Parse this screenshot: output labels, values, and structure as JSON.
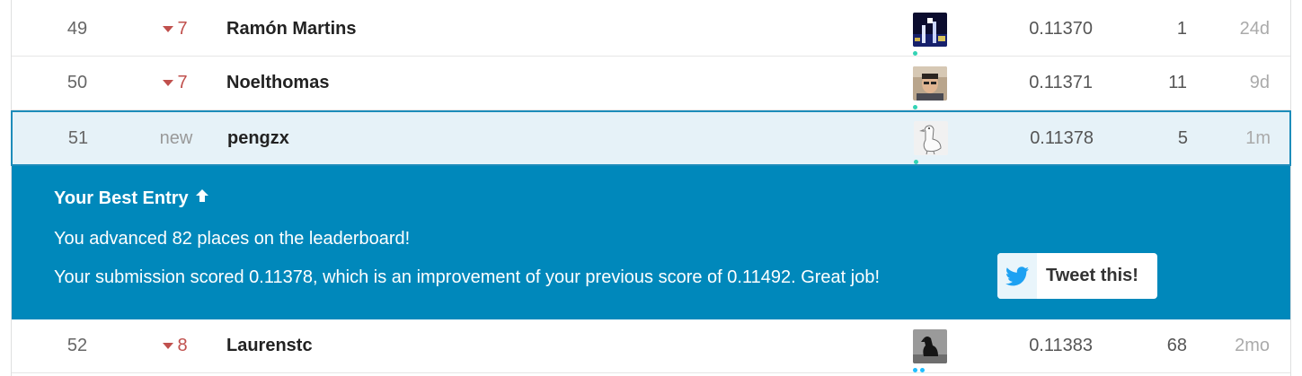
{
  "rows_before": [
    {
      "rank": "49",
      "delta": "7",
      "delta_dir": "down",
      "name": "Ramón Martins",
      "avatar": "dark-blue-image",
      "score": "0.11370",
      "entries": "1",
      "last": "24d"
    },
    {
      "rank": "50",
      "delta": "7",
      "delta_dir": "down",
      "name": "Noelthomas",
      "avatar": "person-photo",
      "score": "0.11371",
      "entries": "11",
      "last": "9d"
    }
  ],
  "current_row": {
    "rank": "51",
    "delta": "new",
    "name": "pengzx",
    "avatar": "goose-sketch",
    "score": "0.11378",
    "entries": "5",
    "last": "1m"
  },
  "best_entry": {
    "title": "Your Best Entry",
    "line1": "You advanced 82 places on the leaderboard!",
    "line2": "Your submission scored 0.11378, which is an improvement of your previous score of 0.11492. Great job!",
    "tweet_label": "Tweet this!"
  },
  "rows_after": [
    {
      "rank": "52",
      "delta": "8",
      "delta_dir": "down",
      "name": "Laurenstc",
      "avatar": "dog-silhouette",
      "score": "0.11383",
      "entries": "68",
      "last": "2mo"
    }
  ],
  "colors": {
    "accent": "#0088bb",
    "highlight_row": "#e6f2f8",
    "down": "#c0504d",
    "twitter": "#1da1f2"
  }
}
